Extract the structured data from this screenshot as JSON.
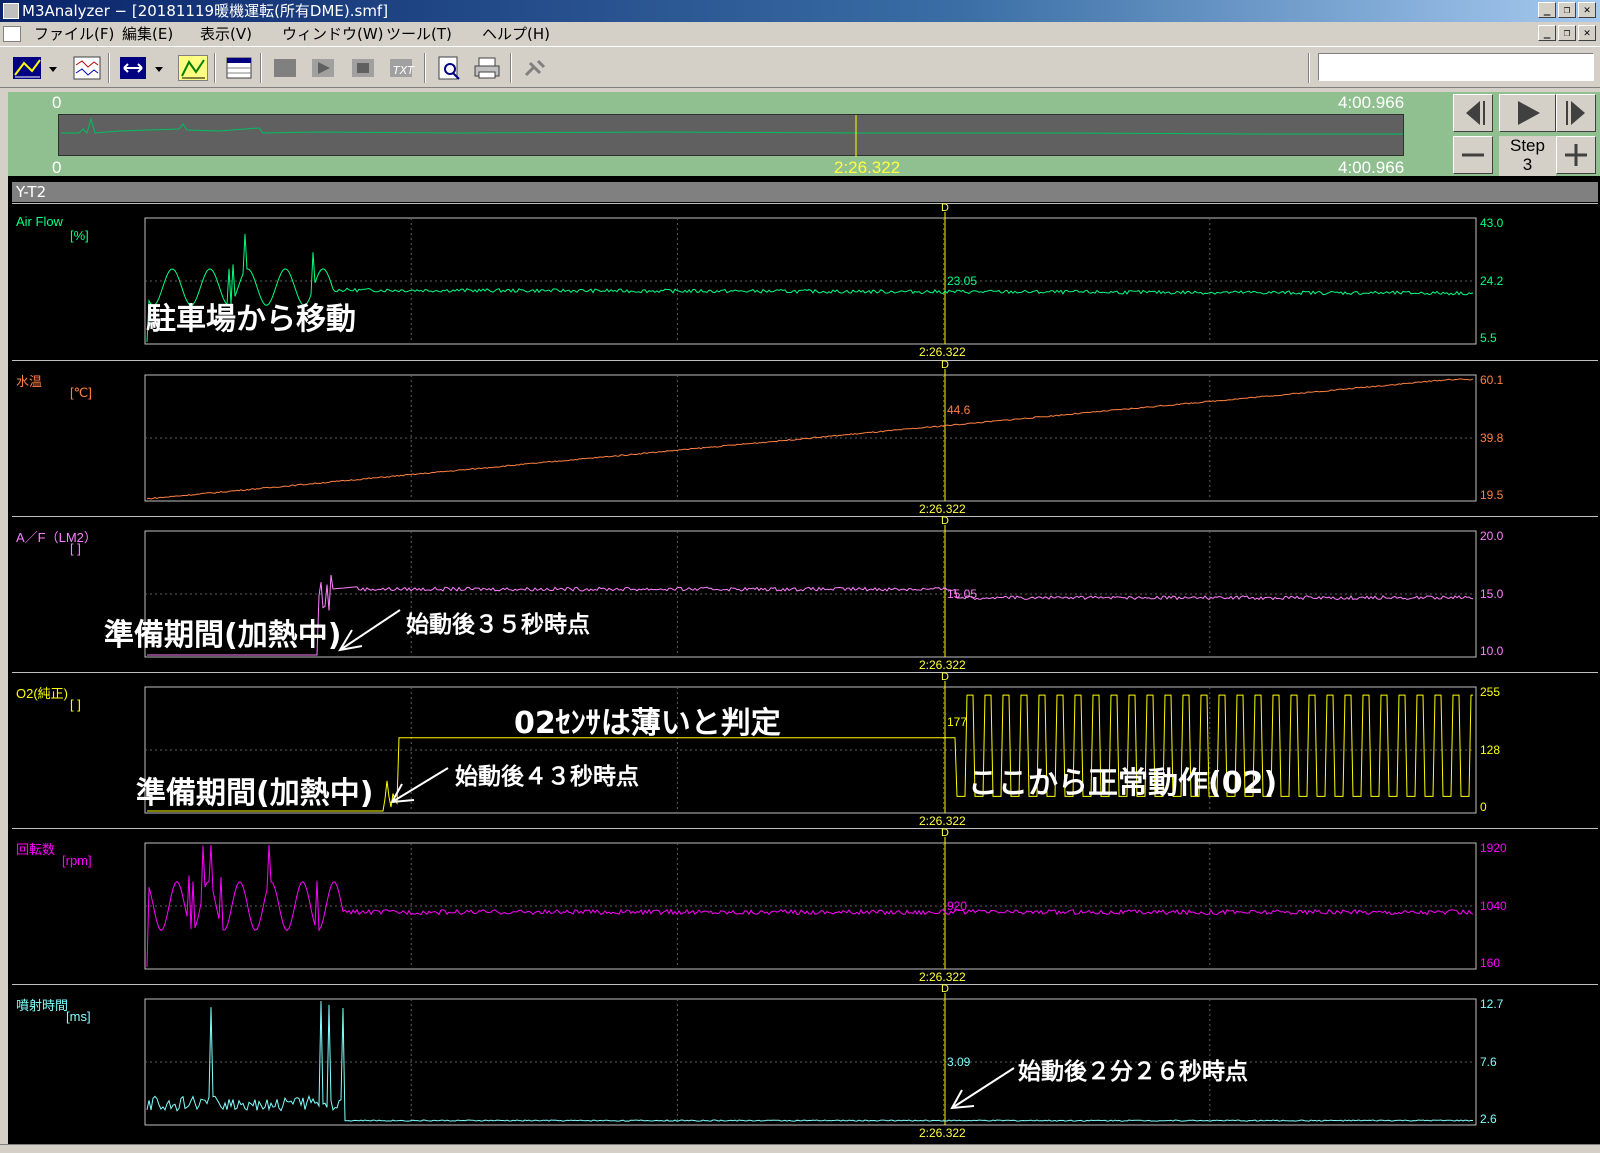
{
  "window": {
    "title": "M3Analyzer − [20181119暖機運転(所有DME).smf]",
    "buttons": {
      "minimize": "_",
      "restore": "❐",
      "close": "✕"
    }
  },
  "menu": [
    "ファイル(F)",
    "編集(E)",
    "表示(V)",
    "ウィンドウ(W)",
    "ツール(T)",
    "ヘルプ(H)"
  ],
  "toolbar": {
    "icons": [
      "graph-type-icon",
      "dropdown-arrow-icon",
      "wave-window-icon",
      "cursor-icon",
      "dropdown-arrow-icon",
      "measure-icon",
      "data-table-icon",
      "stop-icon",
      "play-icon",
      "record-icon",
      "text-icon",
      "preview-icon",
      "print-icon",
      "connect-icon"
    ]
  },
  "overview": {
    "start_top": "0",
    "end_top": "4:00.966",
    "start_bottom": "0",
    "end_bottom": "4:00.966",
    "cursor_time": "2:26.322",
    "step_label": "Step",
    "step_value": "3"
  },
  "view_title": "Y-T2",
  "cursor": {
    "marker": "D",
    "time": "2:26.322"
  },
  "channels": [
    {
      "name": "Air Flow",
      "unit": "[%]",
      "color": "#00ff80",
      "y_max": "43.0",
      "y_mid": "24.2",
      "y_min": "5.5",
      "cursor_value": "23.05"
    },
    {
      "name": "水温",
      "unit": "[℃]",
      "color": "#ff8040",
      "y_max": "60.1",
      "y_mid": "39.8",
      "y_min": "19.5",
      "cursor_value": "44.6"
    },
    {
      "name": "A／F（LM2）",
      "unit": "[ ]",
      "color": "#ff80ff",
      "y_max": "20.0",
      "y_mid": "15.0",
      "y_min": "10.0",
      "cursor_value": "15.05"
    },
    {
      "name": "O2(純正)",
      "unit": "[ ]",
      "color": "#ffff00",
      "y_max": "255",
      "y_mid": "128",
      "y_min": "0",
      "cursor_value": "177"
    },
    {
      "name": "回転数",
      "unit": "[rpm]",
      "color": "#ff00ff",
      "y_max": "1920",
      "y_mid": "1040",
      "y_min": "160",
      "cursor_value": "920"
    },
    {
      "name": "噴射時間",
      "unit": "[ms]",
      "color": "#80ffff",
      "y_max": "12.7",
      "y_mid": "7.6",
      "y_min": "2.6",
      "cursor_value": "3.09"
    }
  ],
  "annotations": {
    "move_from_parking": "駐車場から移動",
    "prep_period_1": "準備期間(加熱中)",
    "start_35s": "始動後３５秒時点",
    "o2_lean": "02ｾﾝｻは薄いと判定",
    "prep_period_2": "準備期間(加熱中)",
    "start_43s": "始動後４３秒時点",
    "normal_from_here": "ここから正常動作(02)",
    "start_2m26s": "始動後２分２６秒時点"
  }
}
